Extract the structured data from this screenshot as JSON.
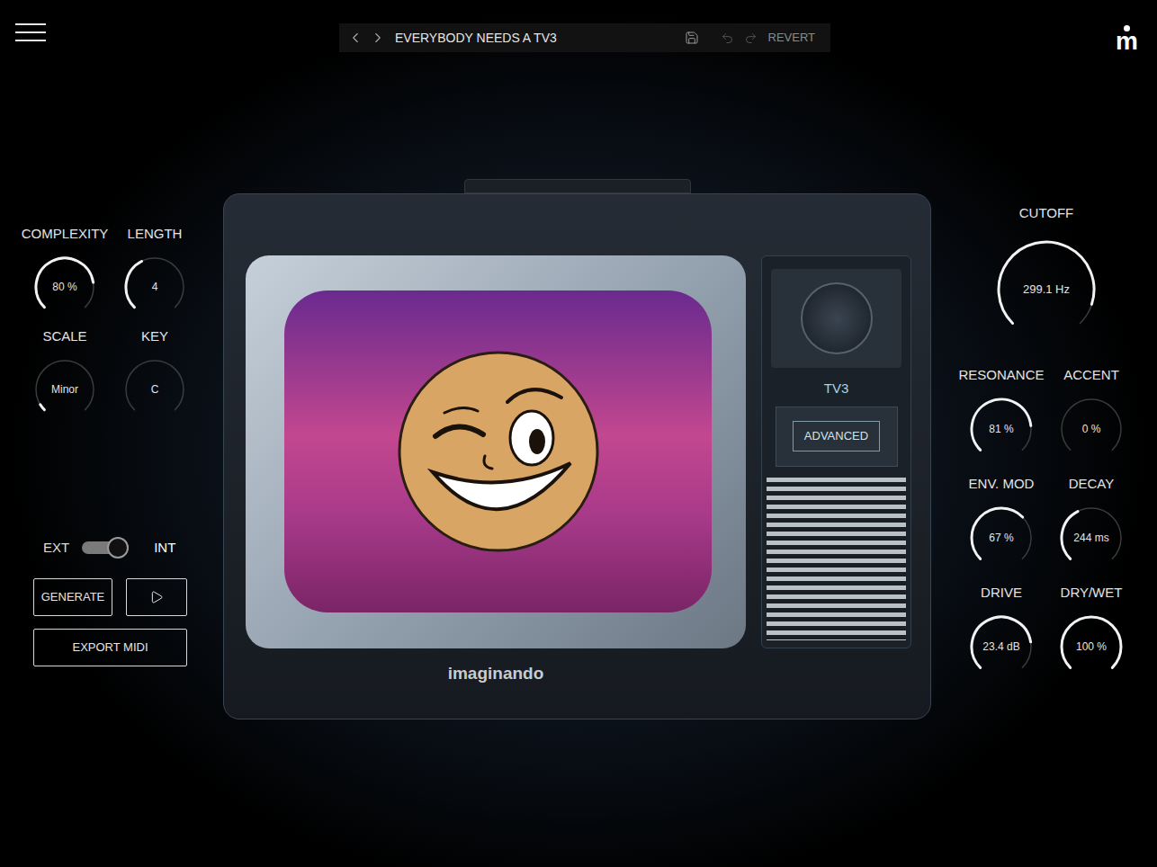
{
  "preset": {
    "name": "EVERYBODY NEEDS A TV3",
    "undo_disabled": true,
    "redo_disabled": true,
    "revert": {
      "label": "REVERT",
      "disabled": true
    }
  },
  "logo": "m",
  "sequencer": {
    "knobs": [
      {
        "label": "COMPLEXITY",
        "value": "80 %",
        "level": 0.8
      },
      {
        "label": "LENGTH",
        "value": "4",
        "level": 0.4
      },
      {
        "label": "SCALE",
        "value": "Minor",
        "level": 0.05
      },
      {
        "label": "KEY",
        "value": "C",
        "level": 0
      }
    ],
    "source": [
      {
        "label": "EXT",
        "selected": false
      },
      {
        "label": "INT",
        "selected": true
      }
    ],
    "generate": "GENERATE",
    "play_playing": false,
    "export": "EXPORT MIDI"
  },
  "tv": {
    "model": "TV3",
    "advanced": "ADVANCED",
    "brand": "imaginando"
  },
  "synth": {
    "cutoff": {
      "label": "CUTOFF",
      "value": "299.1 Hz",
      "level": 0.9
    },
    "knobs": [
      {
        "label": "RESONANCE",
        "value": "81 %",
        "level": 0.81
      },
      {
        "label": "ACCENT",
        "value": "0 %",
        "level": 0
      },
      {
        "label": "ENV. MOD",
        "value": "67 %",
        "level": 0.67
      },
      {
        "label": "DECAY",
        "value": "244 ms",
        "level": 0.4
      },
      {
        "label": "DRIVE",
        "value": "23.4 dB",
        "level": 0.8
      },
      {
        "label": "DRY/WET",
        "value": "100 %",
        "level": 1
      }
    ]
  }
}
